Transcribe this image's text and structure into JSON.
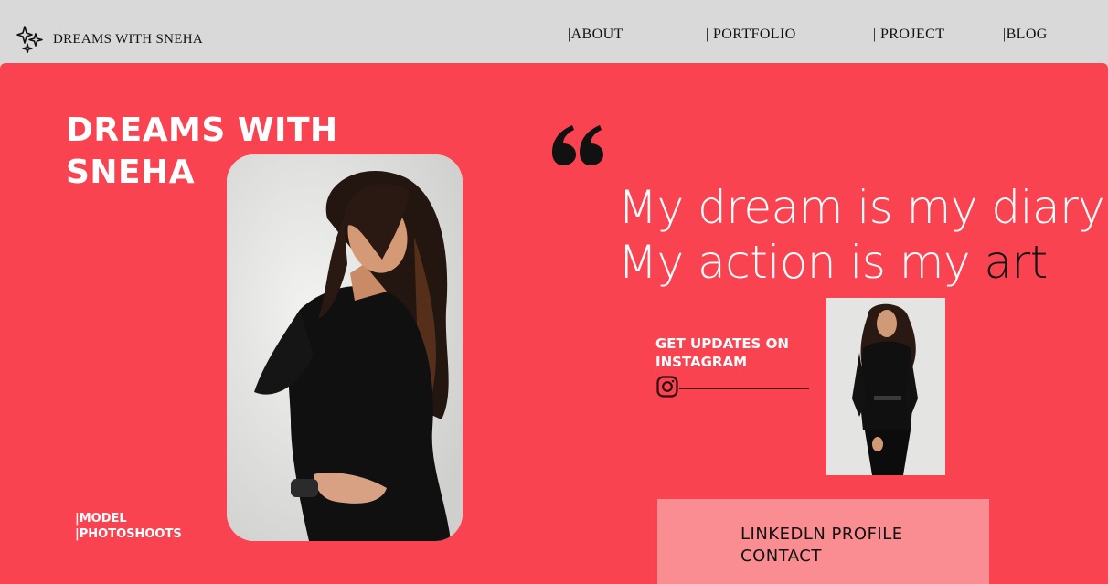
{
  "colors": {
    "hero_bg": "#fa4350",
    "topbar_bg": "#d9d9d9",
    "cta_bg": "#fa8d92",
    "text_dark": "#111111"
  },
  "header": {
    "logo_icon": "sparkles-icon",
    "logo_text": "DREAMS WITH SNEHA",
    "nav": [
      "|ABOUT",
      "| PORTFOLIO",
      "| PROJECT",
      "|BLOG"
    ]
  },
  "hero": {
    "title_line1": "DREAMS WITH",
    "title_line2": "SNEHA",
    "tag1": "|MODEL",
    "tag2": "|PHOTOSHOOTS",
    "quote_icon": "quote-open-icon",
    "quote_line1": "My dream is my diary,",
    "quote_line2_a": "My action is my ",
    "quote_line2_b": "art",
    "instagram_line1": "GET UPDATES ON",
    "instagram_line2": "INSTAGRAM",
    "instagram_icon": "instagram-icon",
    "cta_line1": "LINKEDLN PROFILE",
    "cta_line2": "CONTACT"
  }
}
